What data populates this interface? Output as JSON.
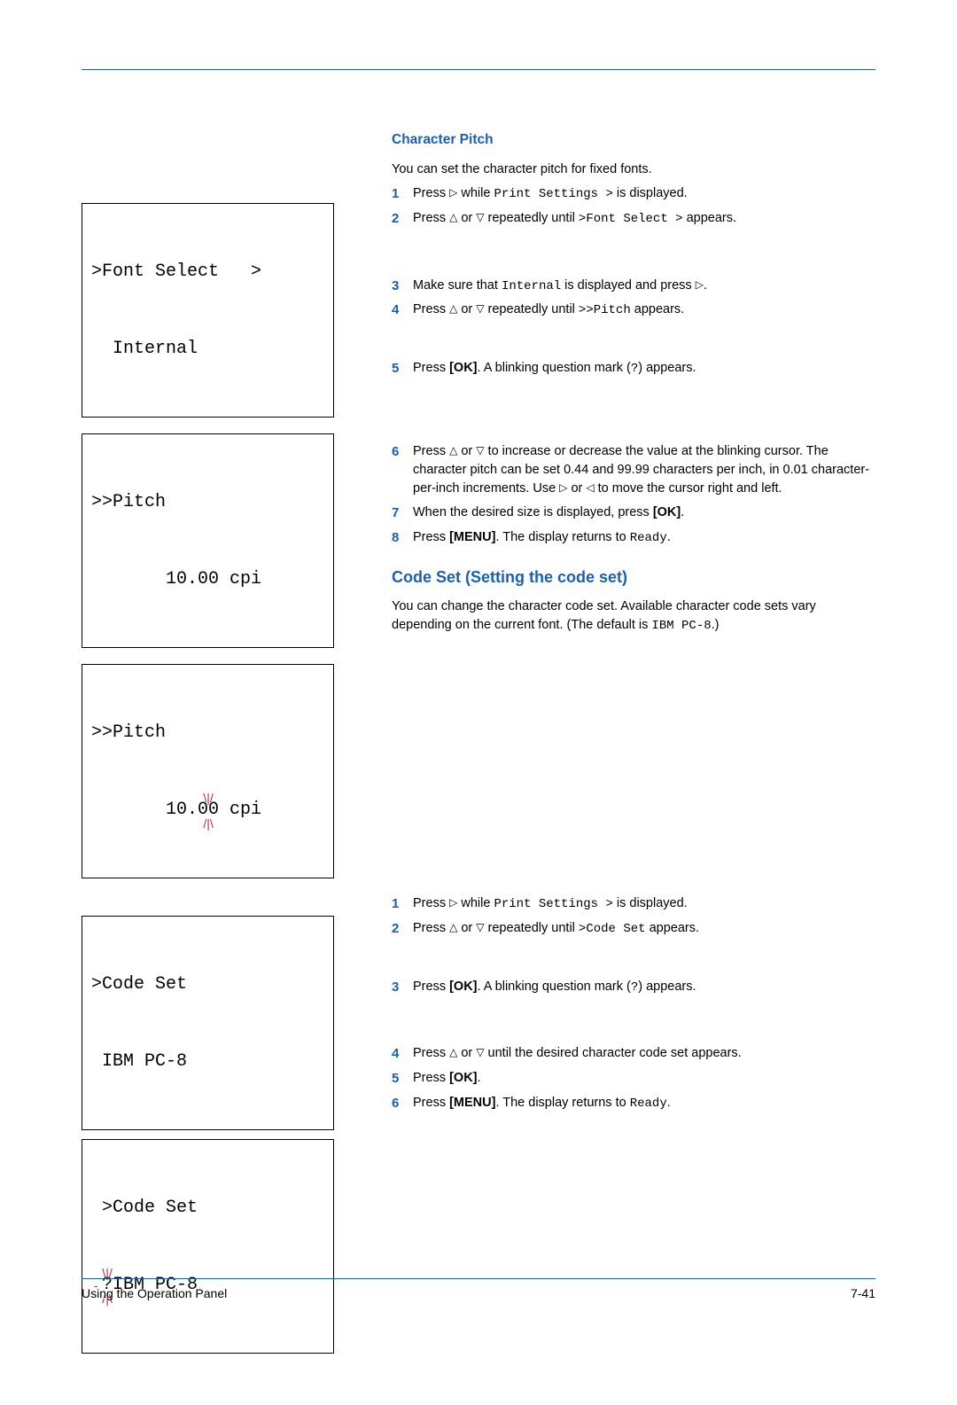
{
  "section1": {
    "title": "Character Pitch",
    "intro": "You can set the character pitch for fixed fonts.",
    "lcd1_line1": ">Font Select   >",
    "lcd1_line2": "  Internal",
    "lcd2_line1": ">>Pitch",
    "lcd2_line2": "       10.00 cpi",
    "lcd3_line1": ">>Pitch",
    "lcd3_pre": "       10.",
    "lcd3_blink": "00",
    "lcd3_post": " cpi",
    "steps": {
      "s1_a": "Press ",
      "s1_b": " while ",
      "s1_c": "Print Settings >",
      "s1_d": " is displayed.",
      "s2_a": "Press ",
      "s2_b": " or ",
      "s2_c": " repeatedly until ",
      "s2_d": ">Font Select  >",
      "s2_e": " appears.",
      "s3_a": "Make sure that ",
      "s3_b": "Internal",
      "s3_c": " is displayed and press ",
      "s3_d": ".",
      "s4_a": "Press ",
      "s4_b": " or ",
      "s4_c": " repeatedly until ",
      "s4_d": ">>Pitch",
      "s4_e": " appears.",
      "s5_a": "Press ",
      "s5_b": "[OK]",
      "s5_c": ". A blinking question mark (",
      "s5_d": "?",
      "s5_e": ") appears.",
      "s6_a": "Press ",
      "s6_b": " or ",
      "s6_c": " to increase or decrease the value at the blinking cursor. The character pitch can be set 0.44 and 99.99 characters per inch, in 0.01 character-per-inch increments. Use ",
      "s6_d": " or ",
      "s6_e": " to move the cursor right and left.",
      "s7_a": "When the desired size is displayed, press ",
      "s7_b": "[OK]",
      "s7_c": ".",
      "s8_a": "Press ",
      "s8_b": "[MENU]",
      "s8_c": ". The display returns to ",
      "s8_d": "Ready",
      "s8_e": "."
    }
  },
  "section2": {
    "title": "Code Set (Setting the code set)",
    "intro_a": "You can change the character code set. Available character code sets vary depending on the current font. (The default is ",
    "intro_b": "IBM PC-8",
    "intro_c": ".)",
    "lcd1_line1": ">Code Set",
    "lcd1_line2": " IBM PC-8",
    "lcd2_line1": " >Code Set",
    "lcd2_blink": "?",
    "lcd2_post": "IBM PC-8",
    "steps": {
      "s1_a": "Press ",
      "s1_b": " while ",
      "s1_c": "Print Settings >",
      "s1_d": " is displayed.",
      "s2_a": "Press ",
      "s2_b": " or ",
      "s2_c": " repeatedly until ",
      "s2_d": ">Code Set",
      "s2_e": " appears.",
      "s3_a": "Press ",
      "s3_b": "[OK]",
      "s3_c": ". A blinking question mark (",
      "s3_d": "?",
      "s3_e": ") appears.",
      "s4_a": "Press ",
      "s4_b": " or ",
      "s4_c": " until the desired character code set appears.",
      "s5_a": "Press ",
      "s5_b": "[OK]",
      "s5_c": ".",
      "s6_a": "Press ",
      "s6_b": "[MENU]",
      "s6_c": ". The display returns to ",
      "s6_d": "Ready",
      "s6_e": "."
    }
  },
  "triangles": {
    "right": "▷",
    "up": "△",
    "down": "▽",
    "left": "◁"
  },
  "footer": {
    "left": "Using the Operation Panel",
    "right": "7-41"
  },
  "nums": {
    "n1": "1",
    "n2": "2",
    "n3": "3",
    "n4": "4",
    "n5": "5",
    "n6": "6",
    "n7": "7",
    "n8": "8"
  }
}
